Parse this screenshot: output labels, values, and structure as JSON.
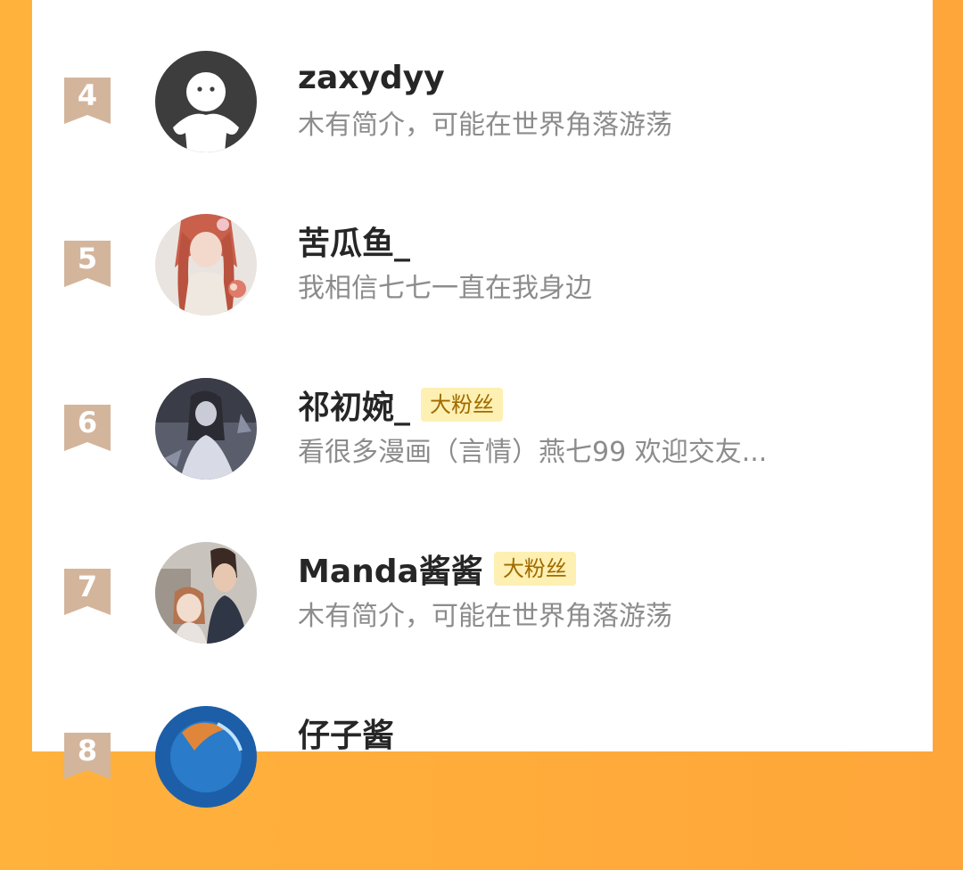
{
  "colors": {
    "background_orange": "#ffa63a",
    "panel": "#ffffff",
    "rank_badge": "#d3b59c",
    "name": "#262626",
    "bio": "#8c8c8c",
    "fan_badge_bg": "#fdf0b2",
    "fan_badge_text": "#a06a00"
  },
  "fans": [
    {
      "rank": "4",
      "name": "zaxydyy",
      "badge": "",
      "bio": "木有简介，可能在世界角落游荡",
      "avatar": "default-avatar-icon"
    },
    {
      "rank": "5",
      "name": "苦瓜鱼_",
      "badge": "",
      "bio": "我相信七七一直在我身边",
      "avatar": "anime-girl-avatar"
    },
    {
      "rank": "6",
      "name": "祁初婉_",
      "badge": "大粉丝",
      "bio": "看很多漫画（言情）燕七99 欢迎交友...",
      "avatar": "dark-illustration-avatar"
    },
    {
      "rank": "7",
      "name": "Manda酱酱",
      "badge": "大粉丝",
      "bio": "木有简介，可能在世界角落游荡",
      "avatar": "couple-illustration-avatar"
    },
    {
      "rank": "8",
      "name": "仔子酱",
      "badge": "",
      "bio": "",
      "avatar": "blue-ocean-avatar"
    }
  ]
}
